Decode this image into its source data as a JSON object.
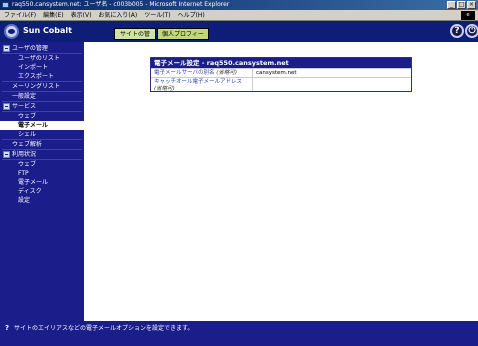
{
  "window": {
    "title": "raq550.cansystem.net: ユーザ名 - c003b005 - Microsoft Internet Explorer",
    "minimize_glyph": "_",
    "maximize_glyph": "□",
    "close_glyph": "×"
  },
  "menubar": {
    "items": [
      "ファイル(F)",
      "編集(E)",
      "表示(V)",
      "お気に入り(A)",
      "ツール(T)",
      "ヘルプ(H)"
    ]
  },
  "header": {
    "brand": "Sun Cobalt",
    "tabs": [
      {
        "label": "サイトの管理",
        "active": true
      },
      {
        "label": "個人プロフィール",
        "active": false
      }
    ],
    "help_glyph": "?",
    "power_glyph": "⏻"
  },
  "sidebar": {
    "items": [
      {
        "label": "ユーザの管理",
        "level": 0,
        "section": true
      },
      {
        "label": "ユーザのリスト",
        "level": 1
      },
      {
        "label": "インポート",
        "level": 1
      },
      {
        "label": "エクスポート",
        "level": 1
      },
      {
        "label": "メーリングリスト",
        "level": 0
      },
      {
        "label": "一般設定",
        "level": 0
      },
      {
        "label": "サービス",
        "level": 0,
        "section": true
      },
      {
        "label": "ウェブ",
        "level": 1
      },
      {
        "label": "電子メール",
        "level": 1,
        "selected": true
      },
      {
        "label": "シェル",
        "level": 1
      },
      {
        "label": "ウェブ解析",
        "level": 0
      },
      {
        "label": "利用状況",
        "level": 0,
        "section": true
      },
      {
        "label": "ウェブ",
        "level": 1
      },
      {
        "label": "FTP",
        "level": 1
      },
      {
        "label": "電子メール",
        "level": 1
      },
      {
        "label": "ディスク",
        "level": 1
      },
      {
        "label": "設定",
        "level": 1
      }
    ]
  },
  "panel": {
    "title": "電子メール設定 - raq550.cansystem.net",
    "rows": [
      {
        "label": "電子メールサーバの別名",
        "note": "(省略可)",
        "value": "cansystem.net"
      },
      {
        "label": "キャッチオール電子メールアドレス",
        "note": "(省略可)",
        "value": ""
      }
    ]
  },
  "status": {
    "icon_glyph": "?",
    "text": "サイトのエイリアスなどの電子メールオプションを設定できます。"
  },
  "colors": {
    "header_bg": "#0e1e78",
    "sidebar_bg": "#1a1d8a",
    "tab_active": "#cfe4a0",
    "tab_inactive": "#c0d876"
  }
}
